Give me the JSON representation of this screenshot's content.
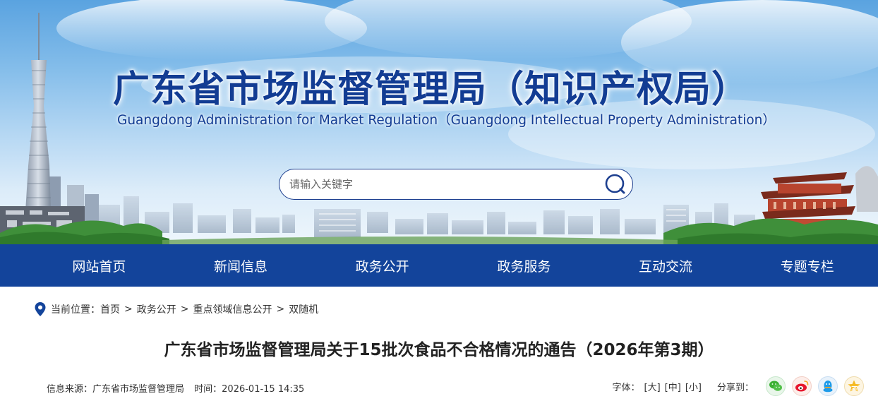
{
  "header": {
    "title": "广东省市场监督管理局（知识产权局）",
    "subtitle": "Guangdong Administration for Market Regulation（Guangdong Intellectual Property Administration）",
    "search": {
      "placeholder": "请输入关键字"
    }
  },
  "nav": {
    "items": [
      "网站首页",
      "新闻信息",
      "政务公开",
      "政务服务",
      "互动交流",
      "专题专栏"
    ]
  },
  "breadcrumb": {
    "label": "当前位置：",
    "items": [
      "首页",
      "政务公开",
      "重点领域信息公开",
      "双随机"
    ],
    "separator": ">"
  },
  "article": {
    "title": "广东省市场监督管理局关于15批次食品不合格情况的通告（2026年第3期）",
    "source_label": "信息来源：广东省市场监督管理局",
    "time_label": "时间：2026-01-15 14:35"
  },
  "tools": {
    "font_label": "字体：",
    "font_large": "[大]",
    "font_medium": "[中]",
    "font_small": "[小]",
    "share_label": "分享到：",
    "share_icons": [
      "wechat-icon",
      "weibo-icon",
      "qq-icon",
      "qzone-icon"
    ]
  },
  "colors": {
    "primary": "#13449b",
    "title_blue": "#123c93"
  }
}
